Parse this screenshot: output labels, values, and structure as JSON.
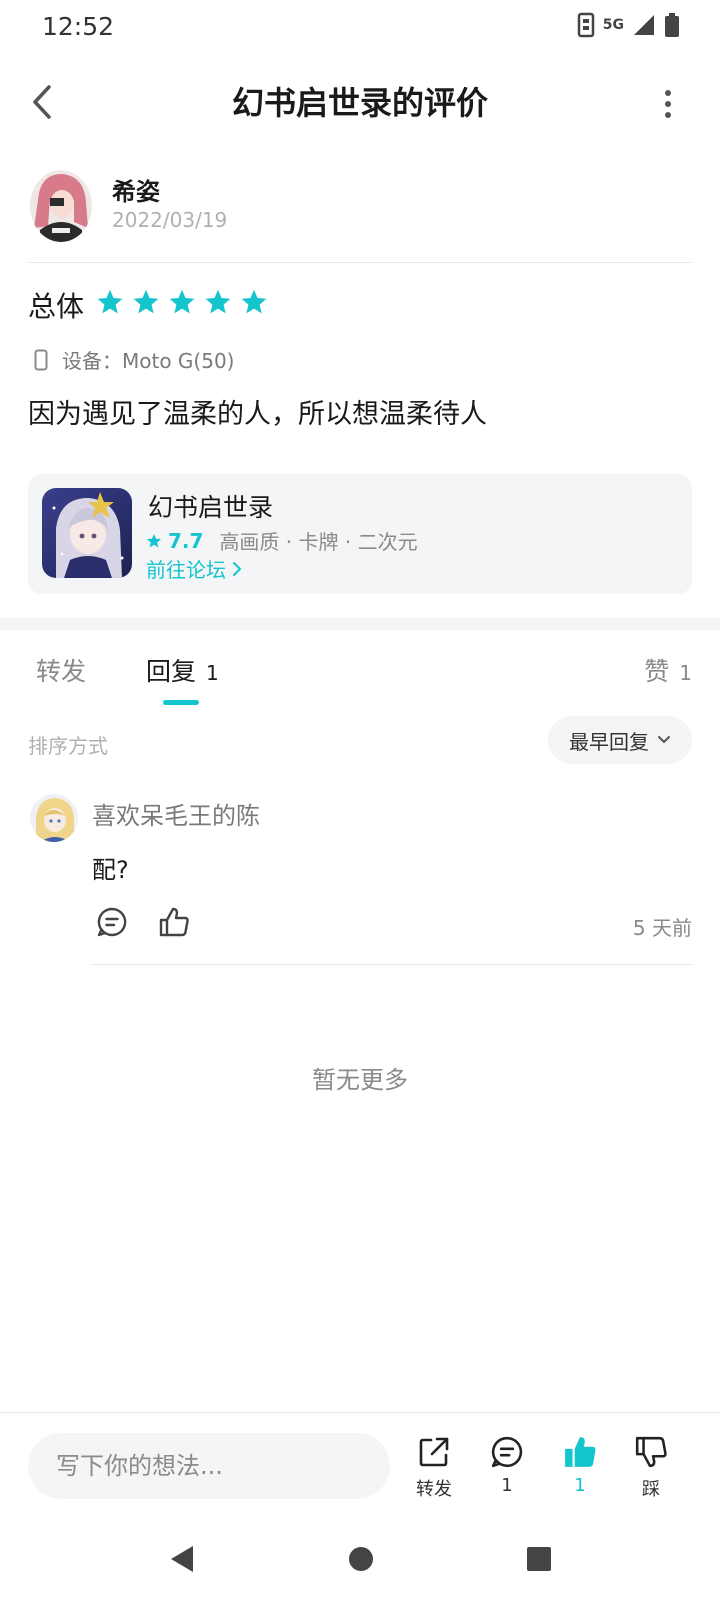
{
  "status_bar": {
    "time": "12:52",
    "network": "5G"
  },
  "header": {
    "title": "幻书启世录的评价"
  },
  "review": {
    "username": "希姿",
    "date": "2022/03/19",
    "overall_label": "总体",
    "rating_stars": 5,
    "device_text": "设备：Moto G(50)",
    "content": "因为遇见了温柔的人，所以想温柔待人"
  },
  "game_card": {
    "name": "幻书启世录",
    "score": "7.7",
    "tags": "高画质 · 卡牌 · 二次元",
    "forum_link": "前往论坛"
  },
  "tabs": [
    {
      "label": "转发",
      "count": ""
    },
    {
      "label": "回复",
      "count": "1"
    },
    {
      "label": "赞",
      "count": "1"
    }
  ],
  "sort": {
    "label": "排序方式",
    "selected": "最早回复"
  },
  "comments": [
    {
      "username": "喜欢呆毛王的陈",
      "text": "配?",
      "time": "5 天前"
    }
  ],
  "no_more_text": "暂无更多",
  "bottom_bar": {
    "input_placeholder": "写下你的想法...",
    "share_label": "转发",
    "comment_count": "1",
    "like_count": "1",
    "dislike_label": "踩"
  },
  "colors": {
    "accent": "#15c5ce",
    "text_primary": "#1a1a1a",
    "text_secondary": "#8a8a8a",
    "card_bg": "#f4f5f7"
  }
}
